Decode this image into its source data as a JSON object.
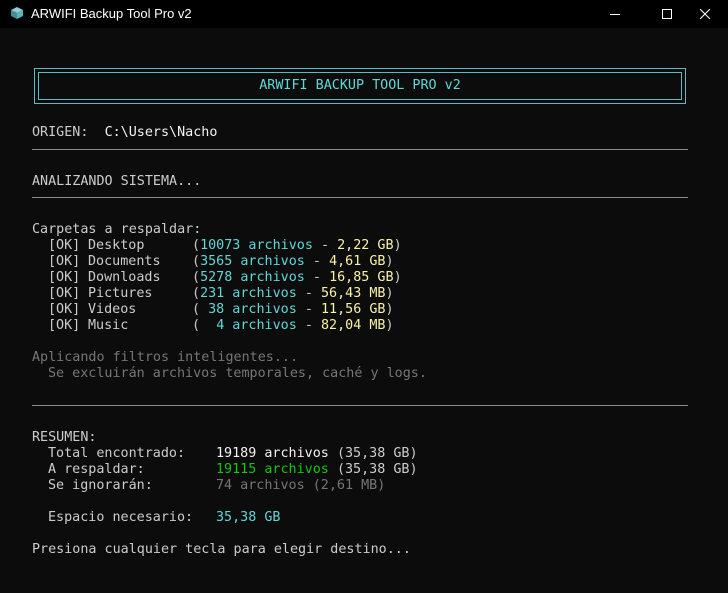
{
  "window": {
    "title": "ARWIFI Backup Tool Pro v2"
  },
  "banner": "ARWIFI BACKUP TOOL PRO v2",
  "origin": {
    "label": "ORIGEN:",
    "path": "C:\\Users\\Nacho"
  },
  "analyzing": "ANALIZANDO SISTEMA...",
  "folders_heading": "Carpetas a respaldar:",
  "folders": [
    {
      "status": "[OK]",
      "name": "Desktop",
      "open": "(",
      "count": "10073 archivos",
      "dash": " - ",
      "size": "2,22 GB",
      "close": ")"
    },
    {
      "status": "[OK]",
      "name": "Documents",
      "open": "(",
      "count": "3565 archivos",
      "dash": " - ",
      "size": "4,61 GB",
      "close": ")"
    },
    {
      "status": "[OK]",
      "name": "Downloads",
      "open": "(",
      "count": "5278 archivos",
      "dash": " - ",
      "size": "16,85 GB",
      "close": ")"
    },
    {
      "status": "[OK]",
      "name": "Pictures",
      "open": "(",
      "count": "231 archivos",
      "dash": " - ",
      "size": "56,43 MB",
      "close": ")"
    },
    {
      "status": "[OK]",
      "name": "Videos",
      "open": "( ",
      "count": "38 archivos",
      "dash": " - ",
      "size": "11,56 GB",
      "close": ")"
    },
    {
      "status": "[OK]",
      "name": "Music",
      "open": "(  ",
      "count": "4 archivos",
      "dash": " - ",
      "size": "82,04 MB",
      "close": ")"
    }
  ],
  "filters": {
    "title": "Aplicando filtros inteligentes...",
    "detail": "Se excluirán archivos temporales, caché y logs."
  },
  "summary": {
    "heading": "RESUMEN:",
    "total_label": "Total encontrado:",
    "total_count": "19189 archivos",
    "total_size": "(35,38 GB)",
    "backup_label": "A respaldar:",
    "backup_count": "19115 archivos",
    "backup_size": "(35,38 GB)",
    "ignored_label": "Se ignorarán:",
    "ignored_count": "74 archivos",
    "ignored_size": "(2,61 MB)",
    "space_label": "Espacio necesario:",
    "space_value": "35,38 GB"
  },
  "prompt": "Presiona cualquier tecla para elegir destino...",
  "colors": {
    "background": "#0c0c0c",
    "cyan": "#61d6d6",
    "yellow": "#f9f1a5",
    "green": "#16c60c",
    "gray": "#767676"
  },
  "icons": [
    "terminal-app-icon",
    "minimize-icon",
    "maximize-icon",
    "close-icon"
  ]
}
